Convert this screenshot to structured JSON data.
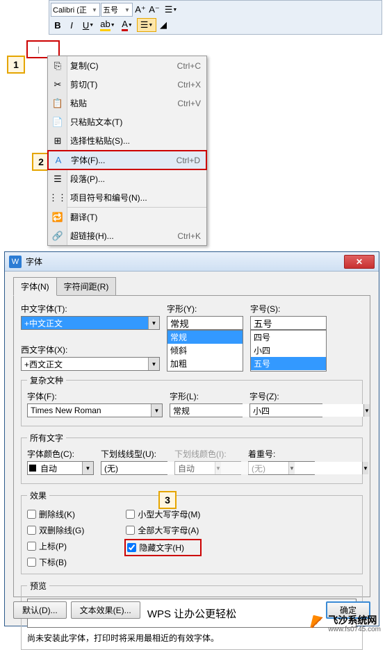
{
  "toolbar": {
    "font_name": "Calibri (正",
    "font_size": "五号",
    "enlarge": "A⁺",
    "shrink": "A⁻",
    "bold": "B",
    "italic": "I",
    "underline": "U"
  },
  "menu": {
    "copy": "复制(C)",
    "copy_key": "Ctrl+C",
    "cut": "剪切(T)",
    "cut_key": "Ctrl+X",
    "paste": "粘贴",
    "paste_key": "Ctrl+V",
    "paste_text": "只粘贴文本(T)",
    "paste_special": "选择性粘贴(S)...",
    "font": "字体(F)...",
    "font_key": "Ctrl+D",
    "paragraph": "段落(P)...",
    "bullets": "项目符号和编号(N)...",
    "translate": "翻译(T)",
    "hyperlink": "超链接(H)...",
    "hyperlink_key": "Ctrl+K"
  },
  "dialog": {
    "title": "字体",
    "icon": "W",
    "tabs": {
      "font": "字体(N)",
      "spacing": "字符间距(R)"
    },
    "labels": {
      "cn_font": "中文字体(T):",
      "west_font": "西文字体(X):",
      "style": "字形(Y):",
      "size": "字号(S):",
      "complex": "复杂文种",
      "complex_font": "字体(F):",
      "complex_style": "字形(L):",
      "complex_size": "字号(Z):",
      "all_text": "所有文字",
      "font_color": "字体颜色(C):",
      "underline_style": "下划线线型(U):",
      "underline_color": "下划线颜色(I):",
      "emphasis": "着重号:",
      "effects": "效果",
      "preview": "预览"
    },
    "values": {
      "cn_font": "+中文正文",
      "west_font": "+西文正文",
      "style": "常规",
      "size": "五号",
      "complex_font": "Times New Roman",
      "complex_style": "常规",
      "complex_size": "小四",
      "font_color": "自动",
      "underline_style": "(无)",
      "underline_color": "自动",
      "emphasis": "(无)"
    },
    "style_list": [
      "常规",
      "倾斜",
      "加粗"
    ],
    "size_list": [
      "四号",
      "小四",
      "五号"
    ],
    "effects": {
      "strike": "删除线(K)",
      "double_strike": "双删除线(G)",
      "superscript": "上标(P)",
      "subscript": "下标(B)",
      "small_caps": "小型大写字母(M)",
      "all_caps": "全部大写字母(A)",
      "hidden": "隐藏文字(H)"
    },
    "preview_text": "WPS 让办公更轻松",
    "preview_note": "尚未安装此字体，打印时将采用最相近的有效字体。",
    "buttons": {
      "default": "默认(D)...",
      "text_effects": "文本效果(E)...",
      "ok": "确定"
    }
  },
  "watermark": {
    "name": "飞沙系统网",
    "url": "www.fs0745.com"
  },
  "callouts": {
    "c1": "1",
    "c2": "2",
    "c3": "3"
  }
}
